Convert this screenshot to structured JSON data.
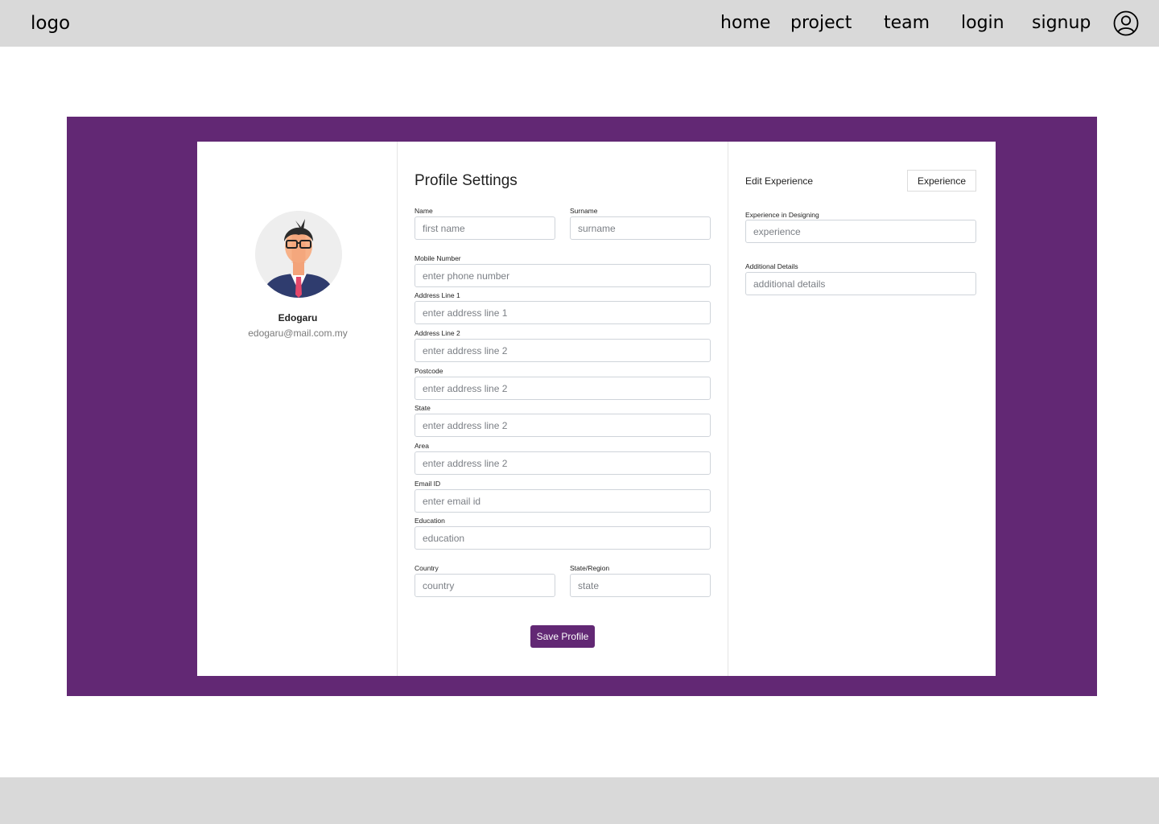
{
  "header": {
    "logo": "logo",
    "nav": [
      "home",
      "project",
      "team",
      "login",
      "signup"
    ],
    "user_icon": "user-circle-icon"
  },
  "profile": {
    "name": "Edogaru",
    "email": "edogaru@mail.com.my",
    "avatar_icon": "avatar-illustration"
  },
  "settings": {
    "title": "Profile Settings",
    "fields": {
      "name": {
        "label": "Name",
        "placeholder": "first name"
      },
      "surname": {
        "label": "Surname",
        "placeholder": "surname"
      },
      "mobile": {
        "label": "Mobile Number",
        "placeholder": "enter phone number"
      },
      "address1": {
        "label": "Address Line 1",
        "placeholder": "enter address line 1"
      },
      "address2": {
        "label": "Address Line 2",
        "placeholder": "enter address line 2"
      },
      "postcode": {
        "label": "Postcode",
        "placeholder": "enter address line 2"
      },
      "state": {
        "label": "State",
        "placeholder": "enter address line 2"
      },
      "area": {
        "label": "Area",
        "placeholder": "enter address line 2"
      },
      "email": {
        "label": "Email ID",
        "placeholder": "enter email id"
      },
      "education": {
        "label": "Education",
        "placeholder": "education"
      },
      "country": {
        "label": "Country",
        "placeholder": "country"
      },
      "region": {
        "label": "State/Region",
        "placeholder": "state"
      }
    },
    "save_label": "Save Profile"
  },
  "experience": {
    "title": "Edit Experience",
    "button_label": "Experience",
    "fields": {
      "designing": {
        "label": "Experience in Designing",
        "placeholder": "experience"
      },
      "details": {
        "label": "Additional Details",
        "placeholder": "additional details"
      }
    }
  },
  "colors": {
    "accent": "#622874",
    "bar": "#d9d9d9"
  }
}
